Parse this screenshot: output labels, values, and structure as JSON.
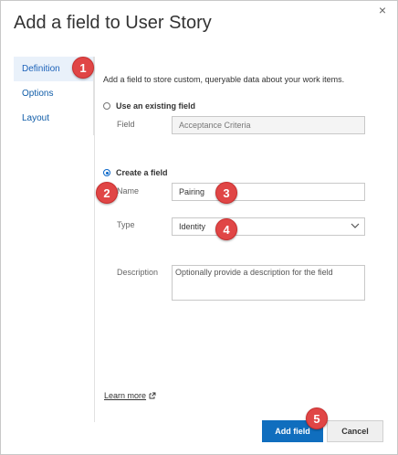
{
  "dialog": {
    "title": "Add a field to User Story",
    "close_symbol": "×"
  },
  "sidebar": {
    "items": [
      {
        "label": "Definition",
        "active": true
      },
      {
        "label": "Options",
        "active": false
      },
      {
        "label": "Layout",
        "active": false
      }
    ]
  },
  "form": {
    "intro": "Add a field to store custom, queryable data about your work items.",
    "use_existing": {
      "label": "Use an existing field",
      "selected": false,
      "field_label": "Field",
      "field_value": "Acceptance Criteria"
    },
    "create": {
      "label": "Create a field",
      "selected": true,
      "name_label": "Name",
      "name_value": "Pairing",
      "type_label": "Type",
      "type_value": "Identity",
      "description_label": "Description",
      "description_placeholder": "Optionally provide a description for the field"
    }
  },
  "footer": {
    "learn_more": "Learn more",
    "add_button": "Add field",
    "cancel_button": "Cancel"
  },
  "callouts": [
    "1",
    "2",
    "3",
    "4",
    "5"
  ],
  "colors": {
    "accent": "#106ebe",
    "callout": "#e04646",
    "active_nav_bg": "#e9f1fa"
  }
}
